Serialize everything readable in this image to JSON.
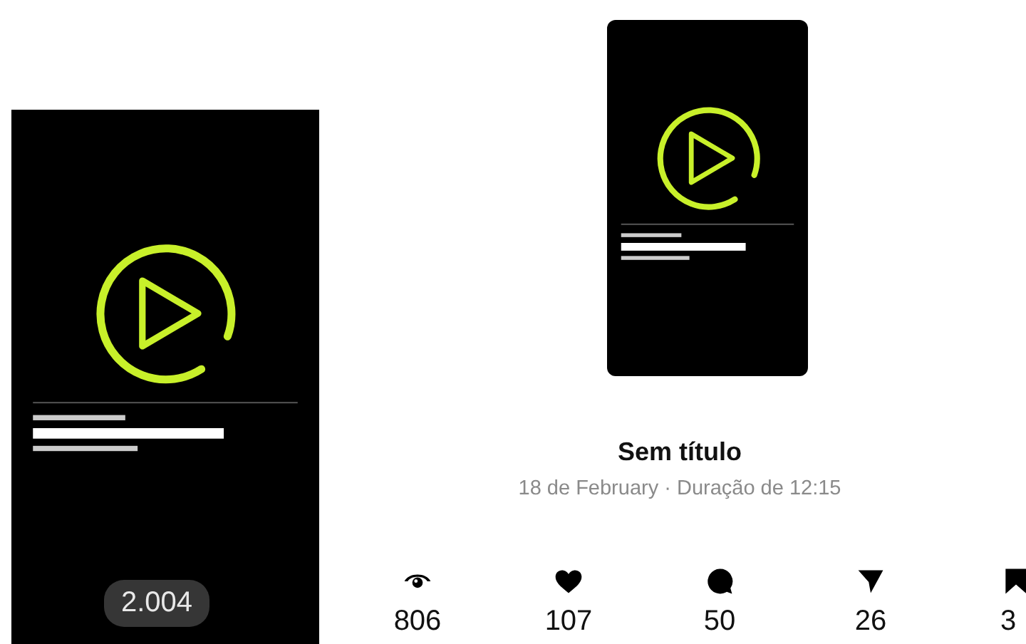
{
  "reel_preview": {
    "plays": "2.004"
  },
  "post": {
    "title": "Sem título",
    "subtitle": "18 de February · Duração de 12:15"
  },
  "stats": [
    {
      "kind": "views",
      "value": "806"
    },
    {
      "kind": "likes",
      "value": "107"
    },
    {
      "kind": "comments",
      "value": "50"
    },
    {
      "kind": "shares",
      "value": "26"
    },
    {
      "kind": "saves",
      "value": "3"
    }
  ]
}
